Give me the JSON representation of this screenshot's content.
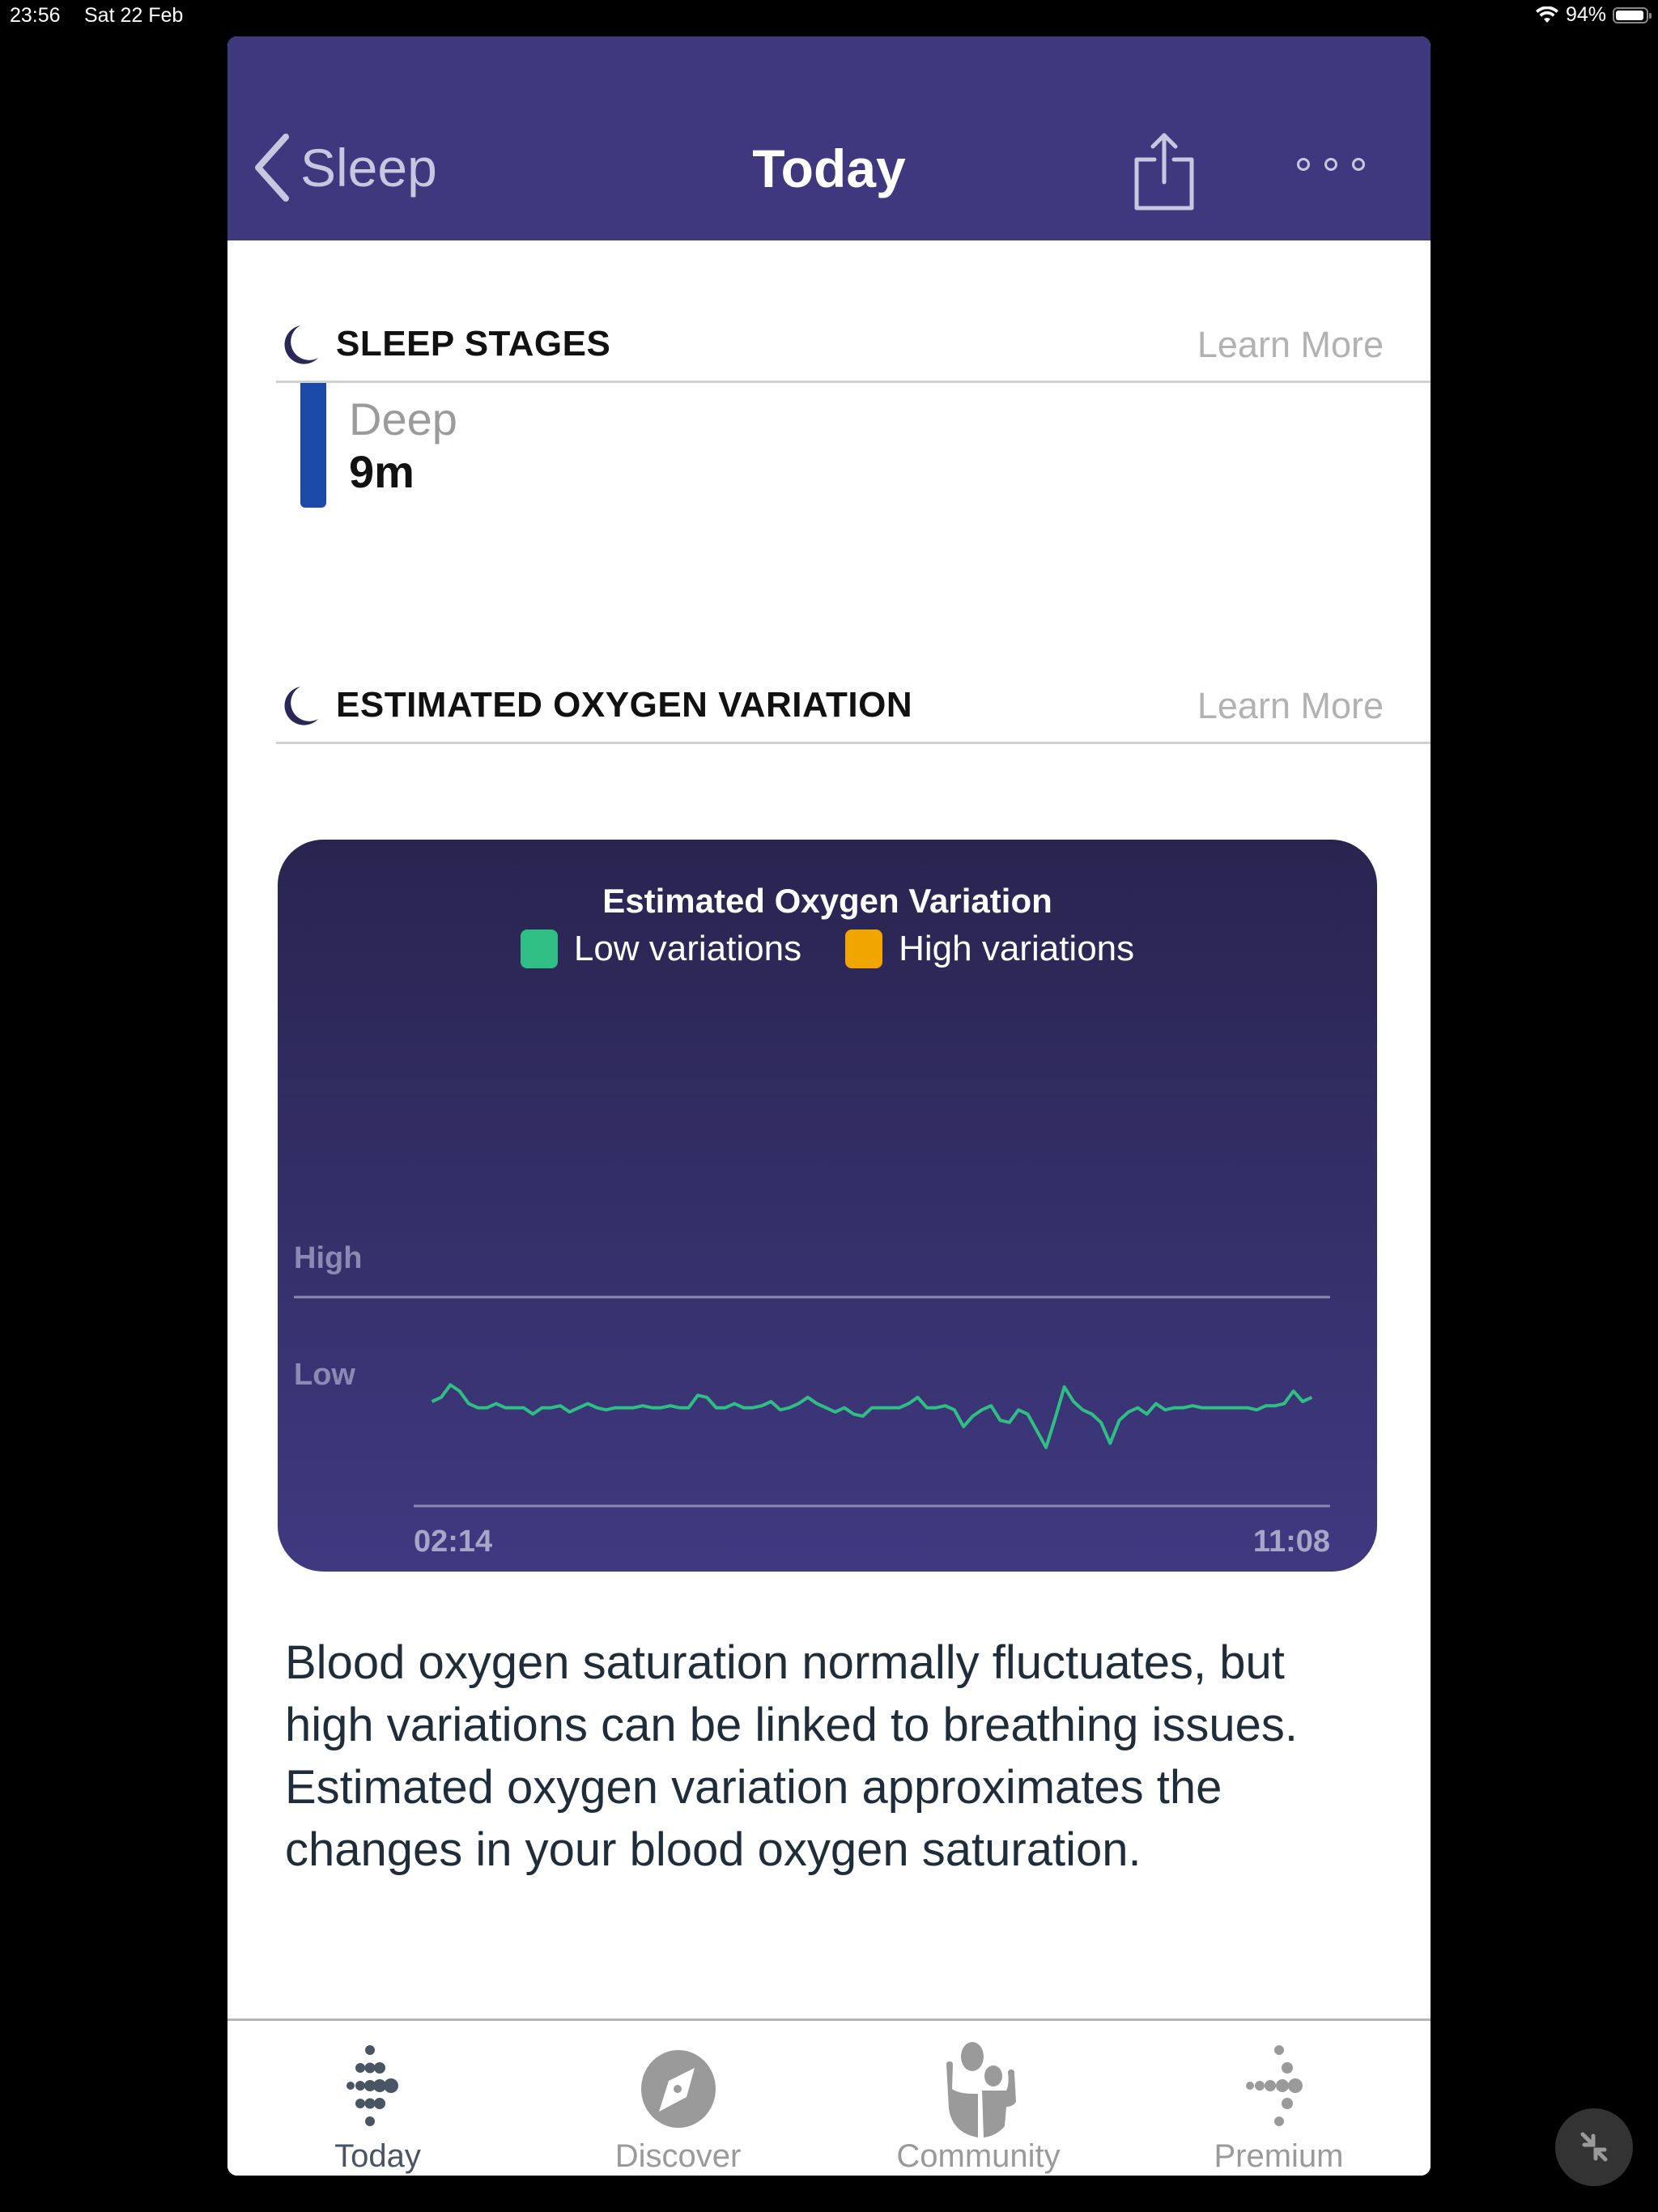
{
  "status_bar": {
    "time": "23:56",
    "date": "Sat 22 Feb",
    "wifi_icon": "wifi-icon",
    "battery_percent": "94%",
    "battery_level": 0.94
  },
  "nav": {
    "back_label": "Sleep",
    "title": "Today",
    "share_icon": "share-icon",
    "more_icon": "more-icon"
  },
  "sleep_stages": {
    "title": "SLEEP STAGES",
    "learn_more": "Learn More",
    "stage": {
      "name": "Deep",
      "value": "9m",
      "color": "#1b4aa8"
    }
  },
  "oxygen_section": {
    "title": "ESTIMATED OXYGEN VARIATION",
    "learn_more": "Learn More"
  },
  "chart_data": {
    "type": "line",
    "title": "Estimated Oxygen Variation",
    "legend": [
      {
        "label": "Low variations",
        "color": "#2fbf85"
      },
      {
        "label": "High variations",
        "color": "#f0a500"
      }
    ],
    "y_labels": [
      "High",
      "Low"
    ],
    "x_labels": [
      "02:14",
      "11:08"
    ],
    "x_range": [
      "02:14",
      "11:08"
    ],
    "ylim": [
      0,
      1
    ],
    "grid": "High threshold line and baseline",
    "series": [
      {
        "name": "Low variations",
        "color": "#2fbf85",
        "x": [
          0.02,
          0.03,
          0.04,
          0.05,
          0.06,
          0.07,
          0.08,
          0.09,
          0.1,
          0.11,
          0.12,
          0.13,
          0.14,
          0.15,
          0.16,
          0.17,
          0.18,
          0.19,
          0.2,
          0.21,
          0.22,
          0.23,
          0.24,
          0.25,
          0.26,
          0.27,
          0.28,
          0.29,
          0.3,
          0.31,
          0.32,
          0.33,
          0.34,
          0.35,
          0.36,
          0.37,
          0.38,
          0.39,
          0.4,
          0.41,
          0.42,
          0.43,
          0.44,
          0.45,
          0.46,
          0.47,
          0.48,
          0.49,
          0.5,
          0.51,
          0.52,
          0.53,
          0.54,
          0.55,
          0.56,
          0.57,
          0.58,
          0.59,
          0.6,
          0.61,
          0.62,
          0.63,
          0.64,
          0.65,
          0.66,
          0.67,
          0.68,
          0.69,
          0.7,
          0.71,
          0.72,
          0.73,
          0.74,
          0.75,
          0.76,
          0.77,
          0.78,
          0.79,
          0.8,
          0.81,
          0.82,
          0.83,
          0.84,
          0.85,
          0.86,
          0.87,
          0.88,
          0.89,
          0.9,
          0.91,
          0.92,
          0.93,
          0.94,
          0.95,
          0.96,
          0.97,
          0.98
        ],
        "y": [
          0.5,
          0.52,
          0.58,
          0.55,
          0.49,
          0.47,
          0.47,
          0.49,
          0.47,
          0.47,
          0.47,
          0.44,
          0.47,
          0.47,
          0.48,
          0.45,
          0.47,
          0.49,
          0.47,
          0.46,
          0.47,
          0.47,
          0.47,
          0.48,
          0.47,
          0.47,
          0.48,
          0.47,
          0.47,
          0.53,
          0.52,
          0.47,
          0.47,
          0.49,
          0.47,
          0.47,
          0.48,
          0.5,
          0.46,
          0.47,
          0.49,
          0.52,
          0.49,
          0.47,
          0.45,
          0.47,
          0.44,
          0.43,
          0.47,
          0.47,
          0.47,
          0.47,
          0.49,
          0.52,
          0.47,
          0.47,
          0.48,
          0.46,
          0.38,
          0.43,
          0.46,
          0.48,
          0.41,
          0.4,
          0.46,
          0.44,
          0.36,
          0.28,
          0.42,
          0.57,
          0.5,
          0.46,
          0.44,
          0.4,
          0.3,
          0.41,
          0.45,
          0.47,
          0.44,
          0.49,
          0.46,
          0.47,
          0.47,
          0.48,
          0.47,
          0.47,
          0.47,
          0.47,
          0.47,
          0.47,
          0.46,
          0.48,
          0.48,
          0.49,
          0.55,
          0.5,
          0.52
        ]
      }
    ]
  },
  "description": "Blood oxygen saturation normally fluctuates, but high variations can be  linked to breathing issues. Estimated oxygen variation approximates the changes in your blood oxygen saturation.",
  "tabs": [
    {
      "label": "Today",
      "icon": "fitbit-logo-icon",
      "active": true
    },
    {
      "label": "Discover",
      "icon": "compass-icon",
      "active": false
    },
    {
      "label": "Community",
      "icon": "community-icon",
      "active": false
    },
    {
      "label": "Premium",
      "icon": "premium-icon",
      "active": false
    }
  ],
  "floating_button": {
    "icon": "minimize-arrows-icon"
  }
}
